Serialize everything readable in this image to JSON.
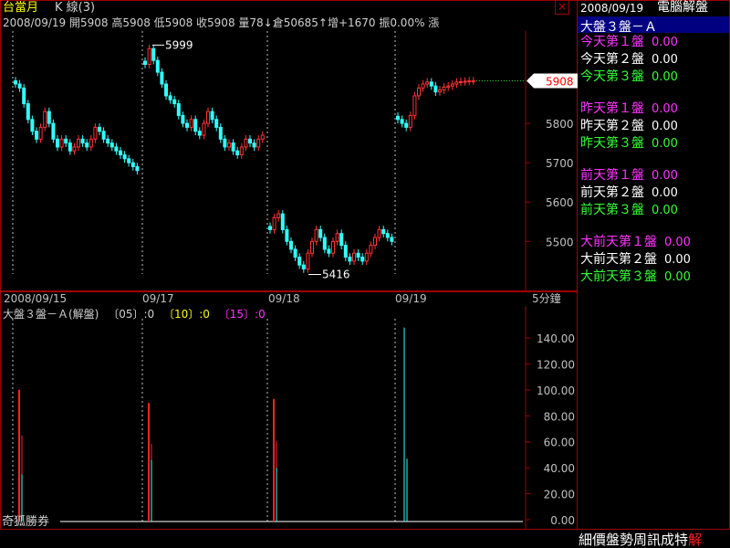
{
  "header": {
    "symbol": "台當月",
    "chart_kind": "K 線(3)",
    "quote": "2008/09/19 開5908 高5908 低5908 收5908 量78↓倉50685↑增+1670 振0.00% 漲",
    "close_btn": "×"
  },
  "footer": {
    "left_label": "奇狐勝券",
    "ticker": "細價盤勢周訊成特",
    "ticker_end": "解"
  },
  "sidebar": {
    "date": "2008/09/19",
    "title": "電腦解盤",
    "selected": "大盤３盤－Ａ",
    "groups": [
      [
        {
          "label": "今天第１盤",
          "value": "0.00",
          "color": "#ff33ff"
        },
        {
          "label": "今天第２盤",
          "value": "0.00",
          "color": "#ffffff"
        },
        {
          "label": "今天第３盤",
          "value": "0.00",
          "color": "#33ff33"
        }
      ],
      [
        {
          "label": "昨天第１盤",
          "value": "0.00",
          "color": "#ff33ff"
        },
        {
          "label": "昨天第２盤",
          "value": "0.00",
          "color": "#ffffff"
        },
        {
          "label": "昨天第３盤",
          "value": "0.00",
          "color": "#33ff33"
        }
      ],
      [
        {
          "label": "前天第１盤",
          "value": "0.00",
          "color": "#ff33ff"
        },
        {
          "label": "前天第２盤",
          "value": "0.00",
          "color": "#ffffff"
        },
        {
          "label": "前天第３盤",
          "value": "0.00",
          "color": "#33ff33"
        }
      ],
      [
        {
          "label": "大前天第１盤",
          "value": "0.00",
          "color": "#ff33ff"
        },
        {
          "label": "大前天第２盤",
          "value": "0.00",
          "color": "#ffffff"
        },
        {
          "label": "大前天第３盤",
          "value": "0.00",
          "color": "#33ff33"
        }
      ]
    ]
  },
  "chart_data": [
    {
      "type": "candlestick",
      "y_ticks": [
        5500,
        5600,
        5700,
        5800
      ],
      "ylim": [
        5380,
        6030
      ],
      "current_price": "5908",
      "annotations": [
        {
          "text": "5999",
          "value": 5999
        },
        {
          "text": "5416",
          "value": 5416
        }
      ],
      "x_labels": [
        "2008/09/15",
        "09/17",
        "09/18",
        "09/19"
      ],
      "period_label": "5分鐘",
      "day_closes": [
        [
          5900,
          5890,
          5850,
          5810,
          5780,
          5760,
          5790,
          5830,
          5800,
          5760,
          5740,
          5760,
          5750,
          5730,
          5740,
          5760,
          5750,
          5740,
          5760,
          5790,
          5780,
          5760,
          5750,
          5740,
          5730,
          5720,
          5710,
          5700,
          5690,
          5680
        ],
        [
          5950,
          5990,
          5960,
          5930,
          5900,
          5870,
          5860,
          5850,
          5820,
          5800,
          5790,
          5810,
          5780,
          5770,
          5800,
          5830,
          5810,
          5790,
          5760,
          5740,
          5750,
          5730,
          5720,
          5740,
          5760,
          5750,
          5740,
          5760,
          5770
        ],
        [
          5530,
          5560,
          5570,
          5530,
          5500,
          5480,
          5460,
          5440,
          5430,
          5470,
          5500,
          5530,
          5510,
          5480,
          5470,
          5500,
          5520,
          5490,
          5460,
          5450,
          5470,
          5460,
          5450,
          5470,
          5490,
          5510,
          5530,
          5520,
          5510,
          5500
        ],
        [
          5810,
          5800,
          5790,
          5820,
          5870,
          5890,
          5900,
          5905,
          5895,
          5880,
          5885,
          5892,
          5895,
          5900,
          5905,
          5906,
          5907,
          5908,
          5908
        ]
      ]
    },
    {
      "type": "bar",
      "title": "大盤３盤－Ａ(解盤)",
      "params": [
        {
          "text": "〔05〕:0",
          "color": "#d0d0d0"
        },
        {
          "text": "〔10〕:0",
          "color": "#ffff00"
        },
        {
          "text": "〔15〕:0",
          "color": "#ff33ff"
        }
      ],
      "y_ticks": [
        "0.00",
        "20.00",
        "40.00",
        "60.00",
        "80.00",
        "100.00",
        "120.00",
        "140.00"
      ],
      "ylim": [
        0,
        152
      ],
      "bars": [
        {
          "day": 0,
          "red": 100,
          "cyan": 35
        },
        {
          "day": 1,
          "red": 90,
          "cyan": 46
        },
        {
          "day": 2,
          "red": 93,
          "cyan": 40
        },
        {
          "day": 3,
          "red": 0,
          "cyan": 148,
          "cyan2": 47
        }
      ]
    }
  ]
}
